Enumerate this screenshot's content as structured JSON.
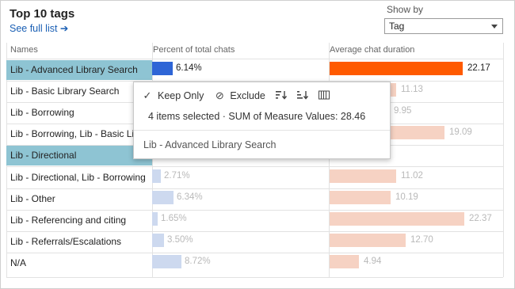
{
  "header": {
    "title": "Top 10 tags",
    "see_full_list": "See full list ➔"
  },
  "show_by": {
    "label": "Show by",
    "value": "Tag"
  },
  "columns": {
    "names": "Names",
    "percent": "Percent of total chats",
    "duration": "Average chat duration"
  },
  "colors": {
    "selected_name_bg": "#8ec4d3",
    "pct_bar_selected": "#2e65d6",
    "pct_bar_faded": "#cdd9ef",
    "dur_bar_selected": "#ff5a00",
    "dur_bar_faded": "#f6d2c3"
  },
  "rows": [
    {
      "name": "Lib - Advanced Library Search",
      "percent": "6.14%",
      "pct_value": 6.14,
      "duration": "22.17",
      "dur_value": 22.17,
      "selected": true
    },
    {
      "name": "Lib - Basic Library Search",
      "percent": "",
      "pct_value": 0,
      "duration": "11.13",
      "dur_value": 11.13,
      "selected": false
    },
    {
      "name": "Lib - Borrowing",
      "percent": "",
      "pct_value": 0,
      "duration": "9.95",
      "dur_value": 9.95,
      "selected": false
    },
    {
      "name": "Lib - Borrowing, Lib - Basic Li",
      "percent": "",
      "pct_value": 0,
      "duration": "19.09",
      "dur_value": 19.09,
      "selected": false
    },
    {
      "name": "Lib - Directional",
      "percent": "",
      "pct_value": 0,
      "duration": "",
      "dur_value": 0,
      "selected": true
    },
    {
      "name": "Lib - Directional, Lib - Borrowing",
      "percent": "2.71%",
      "pct_value": 2.71,
      "duration": "11.02",
      "dur_value": 11.02,
      "selected": false
    },
    {
      "name": "Lib - Other",
      "percent": "6.34%",
      "pct_value": 6.34,
      "duration": "10.19",
      "dur_value": 10.19,
      "selected": false
    },
    {
      "name": "Lib - Referencing and citing",
      "percent": "1.65%",
      "pct_value": 1.65,
      "duration": "22.37",
      "dur_value": 22.37,
      "selected": false
    },
    {
      "name": "Lib - Referrals/Escalations",
      "percent": "3.50%",
      "pct_value": 3.5,
      "duration": "12.70",
      "dur_value": 12.7,
      "selected": false
    },
    {
      "name": "N/A",
      "percent": "8.72%",
      "pct_value": 8.72,
      "duration": "4.94",
      "dur_value": 4.94,
      "selected": false
    }
  ],
  "popup": {
    "keep_only": "Keep Only",
    "exclude": "Exclude",
    "icons": [
      "check-icon",
      "exclude-icon",
      "sort-ascending-icon",
      "sort-descending-icon",
      "view-data-icon"
    ],
    "summary": "4 items selected · SUM of Measure Values: 28.46",
    "item": "Lib - Advanced Library Search"
  }
}
